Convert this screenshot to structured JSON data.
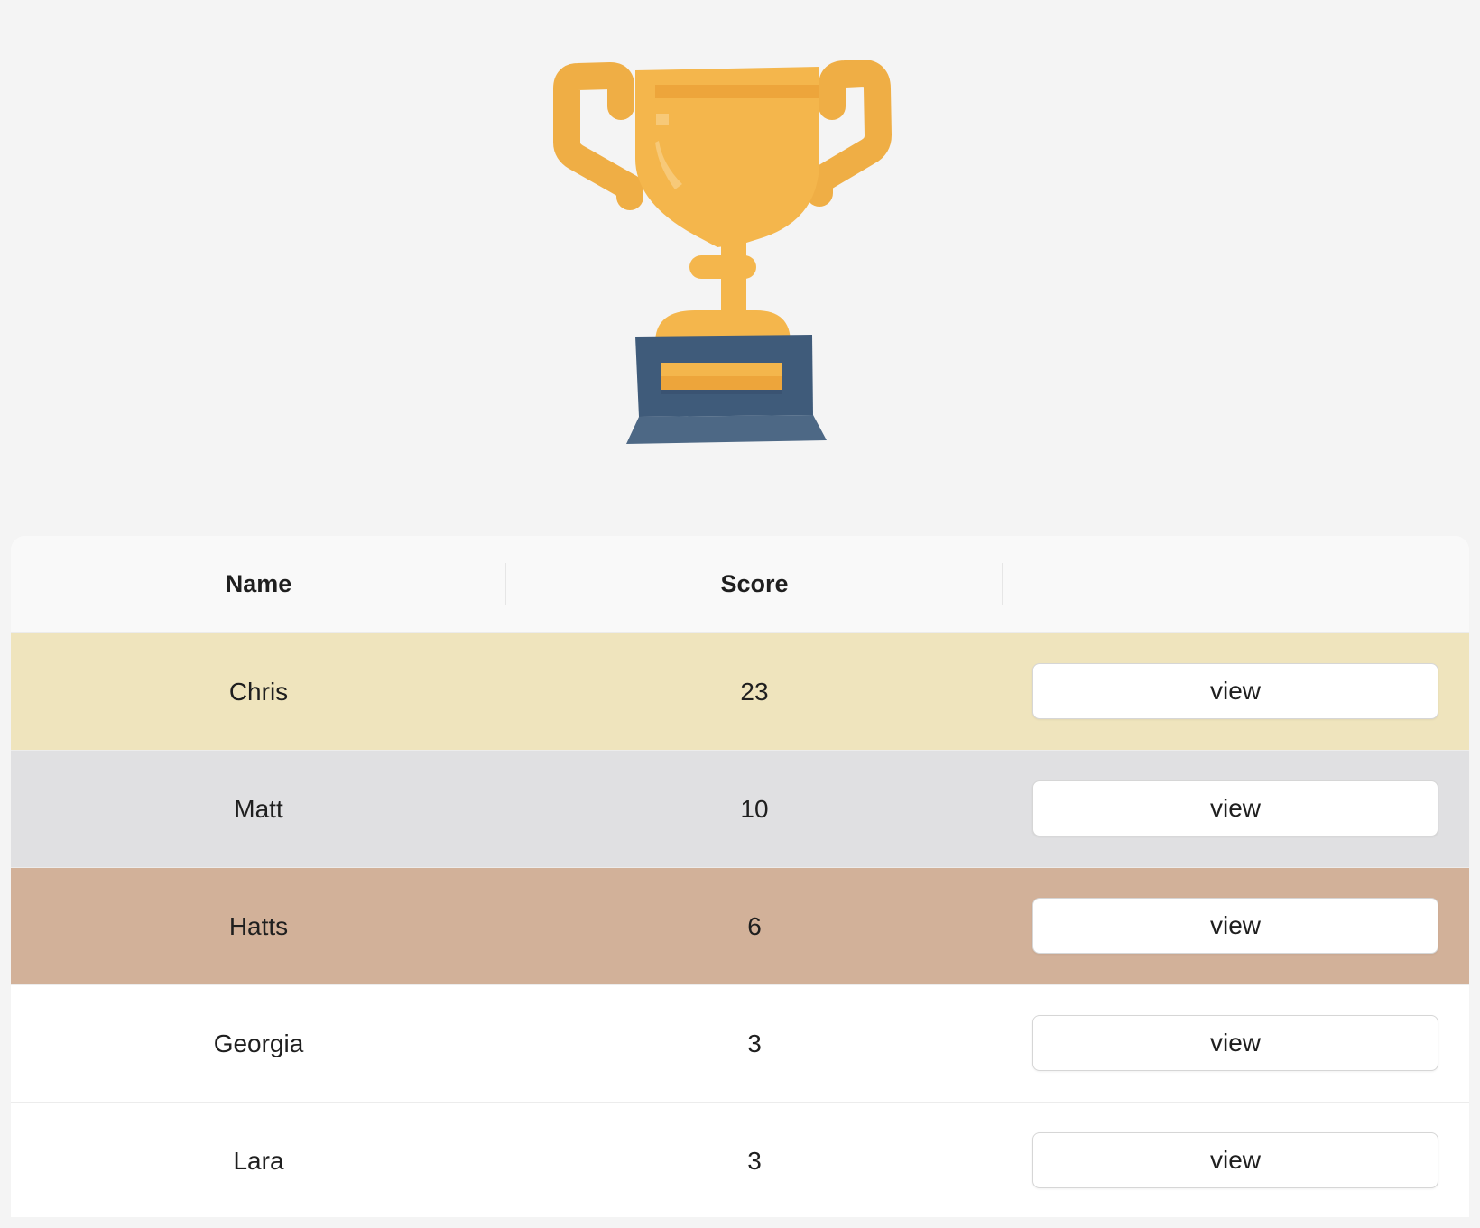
{
  "trophy": {
    "icon": "trophy-icon",
    "colors": {
      "cup": "#f4b64c",
      "cup_shade": "#eda53b",
      "base": "#3f5b7a",
      "base_light": "#4d6885"
    }
  },
  "table": {
    "headers": {
      "name": "Name",
      "score": "Score",
      "action": ""
    },
    "rows": [
      {
        "name": "Chris",
        "score": "23",
        "action_label": "view",
        "highlight": "gold",
        "color": "#efe4bd"
      },
      {
        "name": "Matt",
        "score": "10",
        "action_label": "view",
        "highlight": "silver",
        "color": "#e0e0e2"
      },
      {
        "name": "Hatts",
        "score": "6",
        "action_label": "view",
        "highlight": "bronze",
        "color": "#d2b199"
      },
      {
        "name": "Georgia",
        "score": "3",
        "action_label": "view",
        "highlight": "none",
        "color": "#ffffff"
      },
      {
        "name": "Lara",
        "score": "3",
        "action_label": "view",
        "highlight": "none",
        "color": "#ffffff"
      }
    ]
  }
}
